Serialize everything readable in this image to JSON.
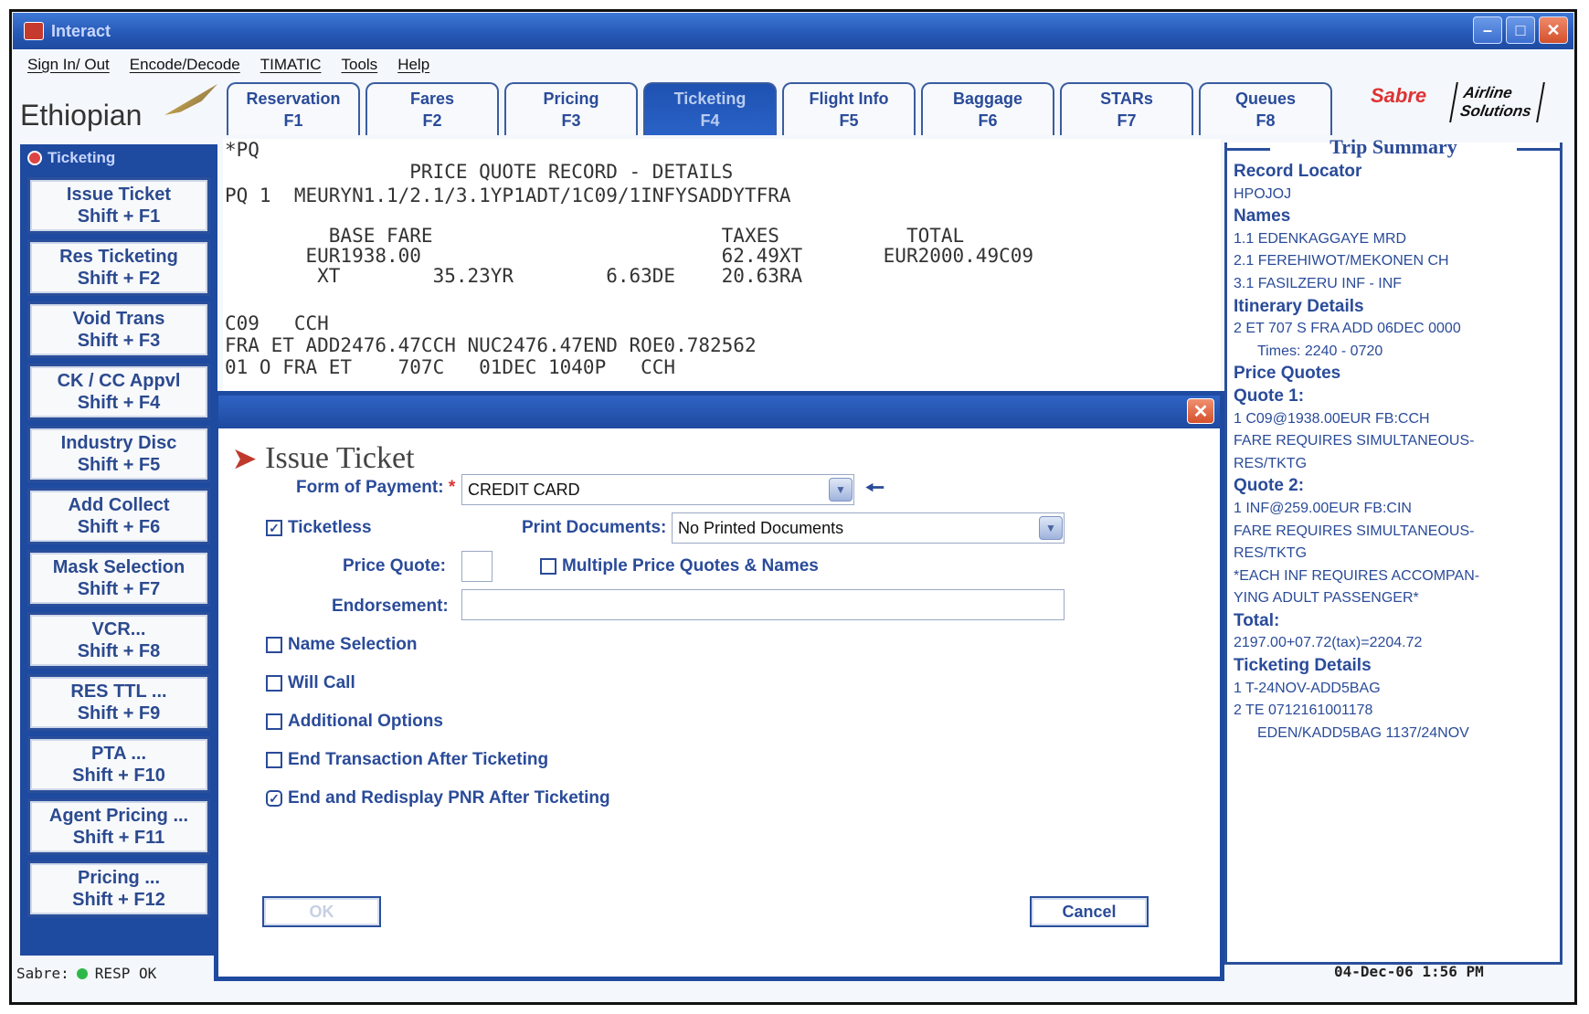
{
  "window": {
    "title": "Interact",
    "controls": {
      "minimize": "–",
      "maximize": "□",
      "close": "✕"
    }
  },
  "menu": [
    "Sign In/ Out",
    "Encode/Decode",
    "TIMATIC",
    "Tools",
    "Help"
  ],
  "brand": {
    "logo_text": "Ethiopian",
    "sabre": "Sabre",
    "airline_solutions_1": "Airline",
    "airline_solutions_2": "Solutions"
  },
  "tabs": [
    {
      "label": "Reservation",
      "key": "F1"
    },
    {
      "label": "Fares",
      "key": "F2"
    },
    {
      "label": "Pricing",
      "key": "F3"
    },
    {
      "label": "Ticketing",
      "key": "F4",
      "active": true
    },
    {
      "label": "Flight Info",
      "key": "F5"
    },
    {
      "label": "Baggage",
      "key": "F6"
    },
    {
      "label": "STARs",
      "key": "F7"
    },
    {
      "label": "Queues",
      "key": "F8"
    }
  ],
  "sidebar": {
    "header": "Ticketing",
    "buttons": [
      {
        "label": "Issue Ticket",
        "key": "Shift + F1"
      },
      {
        "label": "Res Ticketing",
        "key": "Shift + F2"
      },
      {
        "label": "Void Trans",
        "key": "Shift + F3"
      },
      {
        "label": "CK / CC Appvl",
        "key": "Shift + F4"
      },
      {
        "label": "Industry Disc",
        "key": "Shift + F5"
      },
      {
        "label": "Add Collect",
        "key": "Shift + F6"
      },
      {
        "label": "Mask Selection",
        "key": "Shift + F7"
      },
      {
        "label": "VCR...",
        "key": "Shift + F8"
      },
      {
        "label": "RES TTL ...",
        "key": "Shift + F9"
      },
      {
        "label": "PTA ...",
        "key": "Shift + F10"
      },
      {
        "label": "Agent Pricing ...",
        "key": "Shift + F11"
      },
      {
        "label": "Pricing ...",
        "key": "Shift + F12"
      }
    ]
  },
  "terminal": {
    "lines": [
      "*PQ",
      "                PRICE QUOTE RECORD - DETAILS",
      "PQ 1  MEURYN1.1/2.1/3.1YP1ADT/1C09/1INFYSADDYTFRA",
      "         BASE FARE                         TAXES           TOTAL",
      "       EUR1938.00                          62.49XT       EUR2000.49C09",
      "        XT        35.23YR        6.63DE    20.63RA",
      "C09   CCH",
      "FRA ET ADD2476.47CCH NUC2476.47END ROE0.782562",
      "01 O FRA ET    707C   01DEC 1040P   CCH"
    ]
  },
  "trip_summary": {
    "title": "Trip Summary",
    "lines": [
      {
        "text": "Record Locator",
        "h": true
      },
      {
        "text": "HPOJOJ"
      },
      {
        "text": "Names",
        "h": true
      },
      {
        "text": "1.1 EDENKAGGAYE MRD"
      },
      {
        "text": "2.1 FEREHIWOT/MEKONEN CH"
      },
      {
        "text": "3.1 FASILZERU INF - INF"
      },
      {
        "text": "Itinerary Details",
        "h": true
      },
      {
        "text": "2 ET 707 S FRA ADD 06DEC 0000"
      },
      {
        "text": "Times: 2240 - 0720",
        "ind": true
      },
      {
        "text": "Price Quotes",
        "h": true
      },
      {
        "text": "Quote 1:",
        "h": true
      },
      {
        "text": "1 C09@1938.00EUR FB:CCH"
      },
      {
        "text": "FARE REQUIRES SIMULTANEOUS-"
      },
      {
        "text": "RES/TKTG"
      },
      {
        "text": "Quote 2:",
        "h": true
      },
      {
        "text": "1 INF@259.00EUR FB:CIN"
      },
      {
        "text": "FARE REQUIRES SIMULTANEOUS-"
      },
      {
        "text": "RES/TKTG"
      },
      {
        "text": "*EACH INF REQUIRES ACCOMPAN-"
      },
      {
        "text": "YING ADULT PASSENGER*"
      },
      {
        "text": "Total:",
        "h": true
      },
      {
        "text": "2197.00+07.72(tax)=2204.72"
      },
      {
        "text": "Ticketing Details",
        "h": true
      },
      {
        "text": "1 T-24NOV-ADD5BAG"
      },
      {
        "text": "2 TE 0712161001178"
      },
      {
        "text": "EDEN/KADD5BAG 1137/24NOV",
        "ind": true
      }
    ]
  },
  "status": {
    "left": "Sabre:",
    "connection": "RESP OK",
    "right": "04-Dec-06 1:56 PM"
  },
  "dialog": {
    "title": "Issue Ticket",
    "form_of_payment_label": "Form of Payment:",
    "required_mark": "*",
    "form_of_payment_value": "CREDIT CARD",
    "ticketless_label": "Ticketless",
    "ticketless_checked": true,
    "print_documents_label": "Print Documents:",
    "print_documents_value": "No Printed Documents",
    "price_quote_label": "Price Quote:",
    "price_quote_value": "",
    "multiple_pq_label": "Multiple Price Quotes & Names",
    "endorsement_label": "Endorsement:",
    "endorsement_value": "",
    "options": [
      {
        "label": "Name Selection",
        "checked": false
      },
      {
        "label": "Will Call",
        "checked": false
      },
      {
        "label": "Additional Options",
        "checked": false
      },
      {
        "label": "End Transaction After Ticketing",
        "checked": false
      },
      {
        "label": "End and Redisplay PNR After Ticketing",
        "checked": true
      }
    ],
    "ok_label": "OK",
    "cancel_label": "Cancel"
  }
}
